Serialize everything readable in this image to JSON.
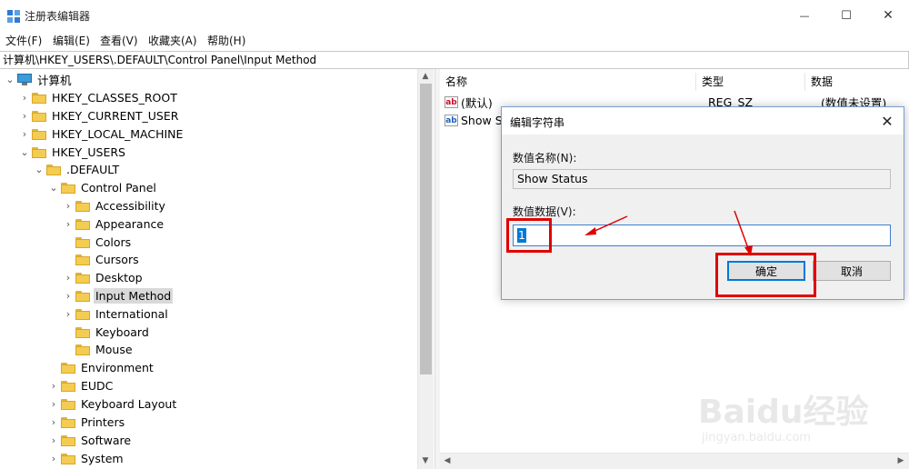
{
  "window": {
    "title": "注册表编辑器",
    "minimize_glyph": "—",
    "maximize_glyph": "☐",
    "close_glyph": "✕"
  },
  "menu": [
    "文件(F)",
    "编辑(E)",
    "查看(V)",
    "收藏夹(A)",
    "帮助(H)"
  ],
  "address": "计算机\\HKEY_USERS\\.DEFAULT\\Control Panel\\Input Method",
  "tree": {
    "root": "计算机",
    "hives": [
      "HKEY_CLASSES_ROOT",
      "HKEY_CURRENT_USER",
      "HKEY_LOCAL_MACHINE",
      "HKEY_USERS"
    ],
    "default": ".DEFAULT",
    "control_panel": "Control Panel",
    "control_panel_children": [
      "Accessibility",
      "Appearance",
      "Colors",
      "Cursors",
      "Desktop",
      "Input Method",
      "International",
      "Keyboard",
      "Mouse"
    ],
    "default_children": [
      "Environment",
      "EUDC",
      "Keyboard Layout",
      "Printers",
      "Software",
      "System"
    ],
    "selected": "Input Method"
  },
  "list": {
    "columns": [
      "名称",
      "类型",
      "数据"
    ],
    "rows": [
      {
        "name": "(默认)",
        "type": "REG_SZ",
        "data": "(数值未设置)",
        "icon": "string-value-icon"
      },
      {
        "name": "Show St",
        "type": "",
        "data": "",
        "icon": "string-value-icon"
      }
    ]
  },
  "dialog": {
    "title": "编辑字符串",
    "value_name_label": "数值名称(N):",
    "value_name": "Show Status",
    "value_data_label": "数值数据(V):",
    "value_data": "1",
    "ok": "确定",
    "cancel": "取消"
  },
  "watermark": {
    "brand": "Baidu经验",
    "url": "jingyan.baidu.com"
  },
  "colors": {
    "highlight": "#e00000",
    "selection": "#0078d7",
    "folder": "#f4cc52"
  }
}
